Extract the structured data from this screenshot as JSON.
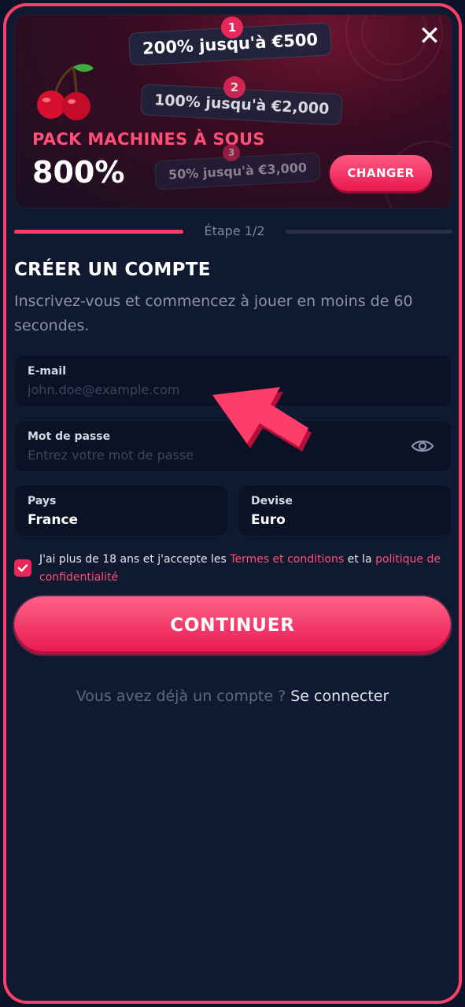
{
  "banner": {
    "pack_title": "PACK MACHINES À SOUS",
    "pack_value": "800%",
    "tiers": [
      {
        "number": "1",
        "text": "200% jusqu'à €500"
      },
      {
        "number": "2",
        "text": "100% jusqu'à €2,000"
      },
      {
        "number": "3",
        "text": "50% jusqu'à €3,000"
      }
    ],
    "change_label": "CHANGER",
    "close_symbol": "✕"
  },
  "progress": {
    "step_label": "Étape 1/2"
  },
  "form": {
    "title": "CRÉER UN COMPTE",
    "subtitle": "Inscrivez-vous et commencez à jouer en moins de 60 secondes.",
    "email": {
      "label": "E-mail",
      "placeholder": "john.doe@example.com",
      "value": ""
    },
    "password": {
      "label": "Mot de passe",
      "placeholder": "Entrez votre mot de passe",
      "value": ""
    },
    "country": {
      "label": "Pays",
      "value": "France"
    },
    "currency": {
      "label": "Devise",
      "value": "Euro"
    },
    "terms": {
      "checked": true,
      "prefix": "J'ai plus de 18 ans et j'accepte les ",
      "terms_link": "Termes et conditions",
      "middle": " et la ",
      "privacy_link": "politique de confidentialité"
    },
    "continue_label": "CONTINUER",
    "login_prompt": "Vous avez déjà un compte ? ",
    "login_link": "Se connecter"
  },
  "colors": {
    "accent": "#ff3d6a",
    "background": "#0f1930",
    "field_bg": "#0a1225"
  },
  "icons": {
    "close": "close-icon",
    "eye": "eye-icon",
    "check": "check-icon",
    "cherry": "cherry-icon",
    "pointer_arrow": "pointer-arrow-icon"
  }
}
